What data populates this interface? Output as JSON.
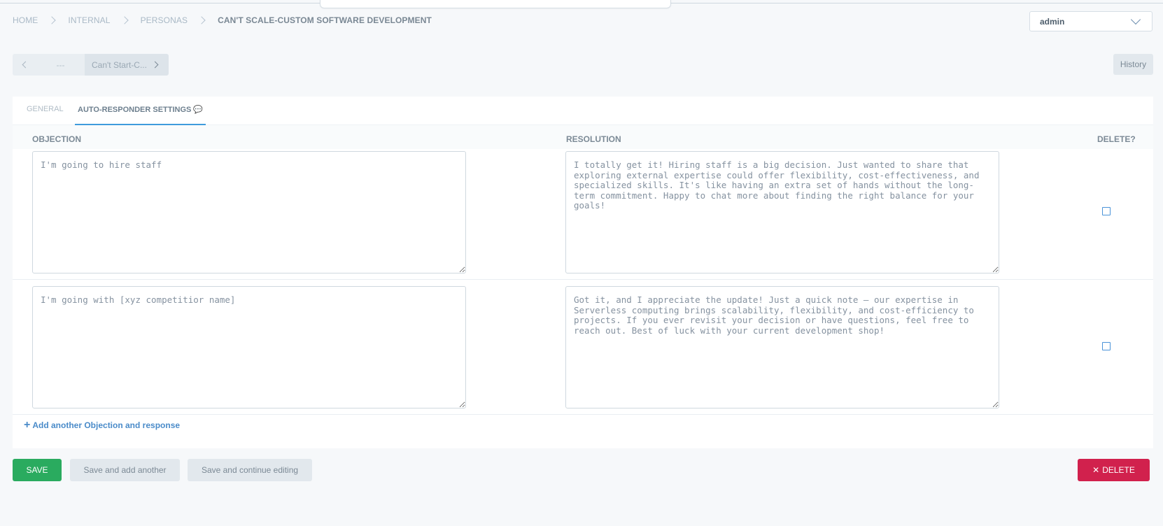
{
  "breadcrumb": {
    "items": [
      "HOME",
      "INTERNAL",
      "PERSONAS"
    ],
    "current": "CAN'T SCALE-CUSTOM SOFTWARE DEVELOPMENT"
  },
  "user_select": {
    "value": "admin"
  },
  "object_nav": {
    "prev_label": "---",
    "next_label": "Can't Start-C..."
  },
  "history_label": "History",
  "tabs": [
    {
      "label": "GENERAL",
      "active": false
    },
    {
      "label": "AUTO-RESPONDER SETTINGS",
      "active": true,
      "icon": "speech-bubble-icon"
    }
  ],
  "table": {
    "headers": {
      "objection": "OBJECTION",
      "resolution": "RESOLUTION",
      "delete": "DELETE?"
    },
    "rows": [
      {
        "objection": "I'm going to hire staff",
        "resolution": "I totally get it! Hiring staff is a big decision. Just wanted to share that exploring external expertise could offer flexibility, cost-effectiveness, and specialized skills. It's like having an extra set of hands without the long-term commitment. Happy to chat more about finding the right balance for your goals!",
        "delete": false
      },
      {
        "objection": "I'm going with [xyz competitior name]",
        "resolution": "Got it, and I appreciate the update! Just a quick note – our expertise in Serverless computing brings scalability, flexibility, and cost-efficiency to projects. If you ever revisit your decision or have questions, feel free to reach out. Best of luck with your current development shop!",
        "delete": false
      }
    ],
    "add_label": "Add another Objection and response"
  },
  "actions": {
    "save": "SAVE",
    "save_add": "Save and add another",
    "save_continue": "Save and continue editing",
    "delete": "DELETE"
  },
  "colors": {
    "save": "#2aab5f",
    "delete": "#d1214d",
    "link": "#4a8bc9",
    "tab_underline": "#3f9bdc"
  }
}
